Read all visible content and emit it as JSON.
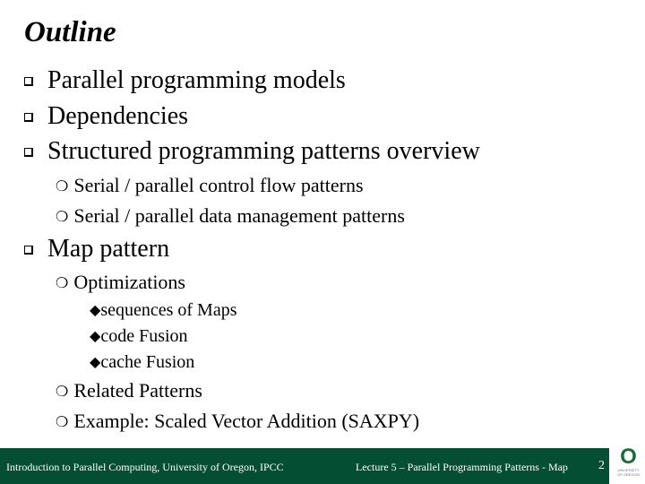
{
  "slide": {
    "title": "Outline",
    "items": [
      {
        "level": 1,
        "bullet": "square-bullet",
        "text": "Parallel programming models"
      },
      {
        "level": 1,
        "bullet": "square-bullet",
        "text": "Dependencies"
      },
      {
        "level": 1,
        "bullet": "square-bullet",
        "text": "Structured programming patterns overview"
      },
      {
        "level": 2,
        "bullet": "circle-bullet",
        "text": "Serial / parallel control flow patterns"
      },
      {
        "level": 2,
        "bullet": "circle-bullet",
        "text": "Serial / parallel data management patterns"
      },
      {
        "level": 1,
        "bullet": "square-bullet",
        "text": "Map pattern"
      },
      {
        "level": 2,
        "bullet": "circle-bullet",
        "text": "Optimizations"
      },
      {
        "level": 3,
        "bullet": "diamond-bullet",
        "text": "sequences of Maps"
      },
      {
        "level": 3,
        "bullet": "diamond-bullet",
        "text": "code Fusion"
      },
      {
        "level": 3,
        "bullet": "diamond-bullet",
        "text": "cache Fusion"
      },
      {
        "level": 2,
        "bullet": "circle-bullet",
        "text": "Related Patterns"
      },
      {
        "level": 2,
        "bullet": "circle-bullet",
        "text": "Example: Scaled Vector Addition (SAXPY)"
      }
    ],
    "glyphs": {
      "circle": "❍",
      "diamond": "◆"
    }
  },
  "footer": {
    "left": "Introduction to Parallel Computing, University of Oregon, IPCC",
    "center": "Lecture 5 – Parallel Programming Patterns - Map",
    "page": "2",
    "logo_letter": "O",
    "logo_text_1": "UNIVERSITY",
    "logo_text_2": "OF OREGON",
    "color": "#044f33"
  }
}
